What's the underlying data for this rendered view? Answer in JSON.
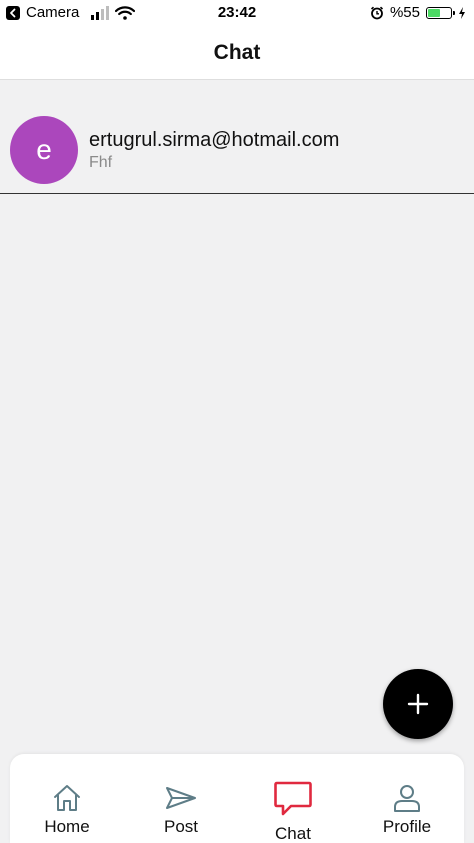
{
  "status_bar": {
    "back_label": "Camera",
    "time": "23:42",
    "battery_text": "%55",
    "battery_level": 0.55
  },
  "header": {
    "title": "Chat"
  },
  "chats": [
    {
      "avatar_letter": "e",
      "avatar_color": "#ab47bc",
      "name": "ertugrul.sirma@hotmail.com",
      "preview": "Fhf"
    }
  ],
  "fab": {
    "icon": "plus-icon"
  },
  "nav": {
    "items": [
      {
        "label": "Home",
        "icon": "home-icon",
        "active": false
      },
      {
        "label": "Post",
        "icon": "send-icon",
        "active": false
      },
      {
        "label": "Chat",
        "icon": "chat-icon",
        "active": true
      },
      {
        "label": "Profile",
        "icon": "person-icon",
        "active": false
      }
    ],
    "active_color": "#e0293f",
    "inactive_color": "#5e7d87"
  }
}
